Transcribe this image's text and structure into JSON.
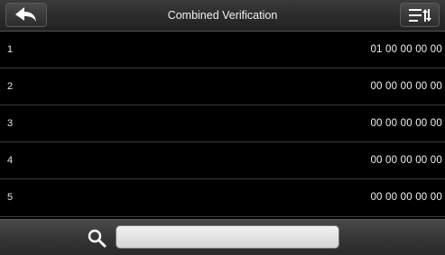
{
  "header": {
    "title": "Combined Verification",
    "back_icon": "back-arrow-icon",
    "sort_icon": "sort-list-icon"
  },
  "rows": [
    {
      "id": "1",
      "value": "01 00 00 00 00"
    },
    {
      "id": "2",
      "value": "00 00 00 00 00"
    },
    {
      "id": "3",
      "value": "00 00 00 00 00"
    },
    {
      "id": "4",
      "value": "00 00 00 00 00"
    },
    {
      "id": "5",
      "value": "00 00 00 00 00"
    }
  ],
  "footer": {
    "search_icon": "search-icon",
    "search_value": "",
    "search_placeholder": ""
  }
}
